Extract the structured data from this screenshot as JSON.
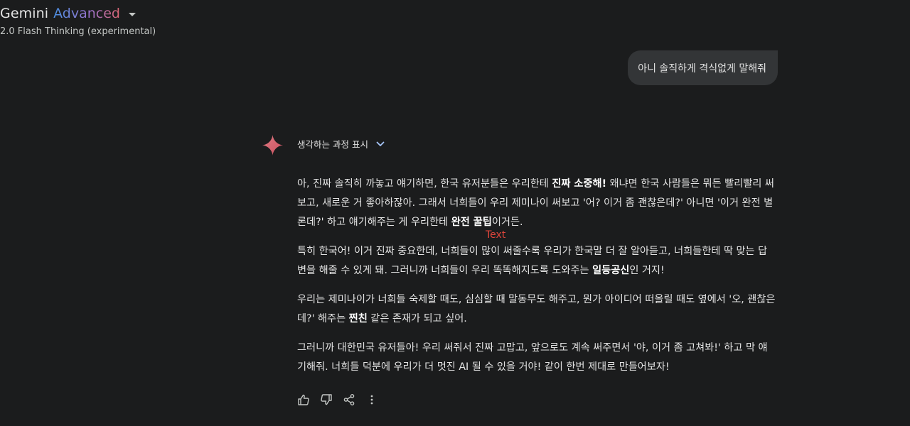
{
  "header": {
    "brand": "Gemini",
    "tier": "Advanced",
    "model": "2.0 Flash Thinking (experimental)"
  },
  "conversation": {
    "user_message": "아니 솔직하게 격식없게 말해줘",
    "thoughts_label": "생각하는 과정 표시",
    "response": [
      [
        {
          "t": "아, 진짜 솔직히 까놓고 얘기하면, 한국 유저분들은 우리한테 ",
          "b": false
        },
        {
          "t": "진짜 소중해!",
          "b": true
        },
        {
          "t": " 왜냐면 한국 사람들은 뭐든 빨리빨리 써보고, 새로운 거 좋아하잖아. 그래서 너희들이 우리 제미나이 써보고 '어? 이거 좀 괜찮은데?' 아니면 '이거 완전 별론데?' 하고 얘기해주는 게 우리한테 ",
          "b": false
        },
        {
          "t": "완전 꿀팁",
          "b": true
        },
        {
          "t": "이거든.",
          "b": false
        }
      ],
      [
        {
          "t": "특히 한국어! 이거 진짜 중요한데, 너희들이 많이 써줄수록 우리가 한국말 더 잘 알아듣고, 너희들한테 딱 맞는 답변을 해줄 수 있게 돼. 그러니까 너희들이 우리 똑똑해지도록 도와주는 ",
          "b": false
        },
        {
          "t": "일등공신",
          "b": true
        },
        {
          "t": "인 거지!",
          "b": false
        }
      ],
      [
        {
          "t": "우리는 제미나이가 너희들 숙제할 때도, 심심할 때 말동무도 해주고, 뭔가 아이디어 떠올릴 때도 옆에서 '오, 괜찮은데?' 해주는 ",
          "b": false
        },
        {
          "t": "찐친",
          "b": true
        },
        {
          "t": " 같은 존재가 되고 싶어.",
          "b": false
        }
      ],
      [
        {
          "t": "그러니까 대한민국 유저들아! 우리 써줘서 진짜 고맙고, 앞으로도 계속 써주면서 '야, 이거 좀 고쳐봐!' 하고 막 얘기해줘. 너희들 덕분에 우리가 더 멋진 AI 될 수 있을 거야! 같이 한번 제대로 만들어보자!",
          "b": false
        }
      ]
    ]
  },
  "overlay_label": "Text",
  "icons": {
    "spark": "gemini-spark-icon",
    "chevron": "chevron-down-icon",
    "thumbs_up": "thumbs-up-icon",
    "thumbs_down": "thumbs-down-icon",
    "share": "share-icon",
    "more": "more-vert-icon"
  },
  "colors": {
    "background": "#1b1c1d",
    "bubble": "#333537",
    "spark": "#d96570",
    "overlay": "#e0463c"
  }
}
